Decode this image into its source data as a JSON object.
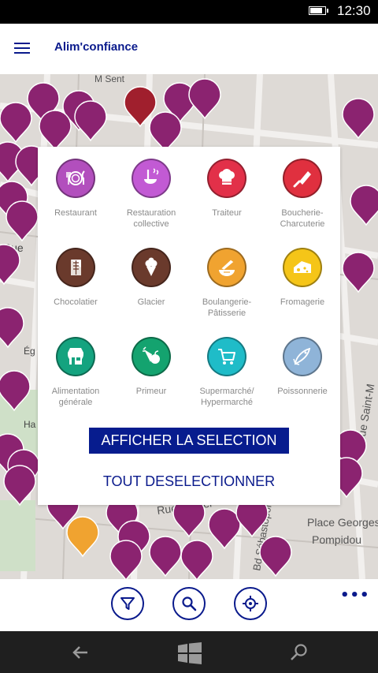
{
  "status": {
    "time": "12:30",
    "battery_level": 0.9
  },
  "app": {
    "title": "Alim'confiance"
  },
  "map": {
    "labels": [
      "M Sent",
      "Rue",
      "Ég",
      "Ha",
      "Place Georges",
      "Pompidou",
      "Rue Berger",
      "Bd Sébastopol",
      "Rue Saint-M"
    ]
  },
  "panel": {
    "categories": [
      {
        "label": "Restaurant",
        "color": "#b24fbd",
        "icon": "plate-icon"
      },
      {
        "label": "Restauration\ncollective",
        "color": "#c25ad4",
        "icon": "ladle-icon"
      },
      {
        "label": "Traiteur",
        "color": "#e23049",
        "icon": "chef-hat-icon"
      },
      {
        "label": "Boucherie-\nCharcuterie",
        "color": "#e0303f",
        "icon": "cleaver-icon"
      },
      {
        "label": "Chocolatier",
        "color": "#6a3a2c",
        "icon": "chocolate-bar-icon"
      },
      {
        "label": "Glacier",
        "color": "#6a3a2c",
        "icon": "ice-cream-icon"
      },
      {
        "label": "Boulangerie-\nPâtisserie",
        "color": "#f0a330",
        "icon": "bread-icon"
      },
      {
        "label": "Fromagerie",
        "color": "#f5c518",
        "icon": "cheese-icon"
      },
      {
        "label": "Alimentation\ngénérale",
        "color": "#14a37f",
        "icon": "shop-icon"
      },
      {
        "label": "Primeur",
        "color": "#14a36f",
        "icon": "vegetables-icon"
      },
      {
        "label": "Supermarché/\nHypermarché",
        "color": "#1fbcc8",
        "icon": "cart-icon"
      },
      {
        "label": "Poissonnerie",
        "color": "#8fb4d8",
        "icon": "fish-icon"
      }
    ],
    "show_selection": "AFFICHER LA SELECTION",
    "deselect_all": "TOUT DESELECTIONNER"
  },
  "toolbar": {
    "buttons": [
      {
        "name": "filter",
        "icon": "filter-icon"
      },
      {
        "name": "search",
        "icon": "search-icon"
      },
      {
        "name": "locate",
        "icon": "locate-icon"
      }
    ],
    "more": "•••"
  },
  "navbar": {
    "icons": [
      "back-icon",
      "windows-icon",
      "search-icon"
    ]
  }
}
